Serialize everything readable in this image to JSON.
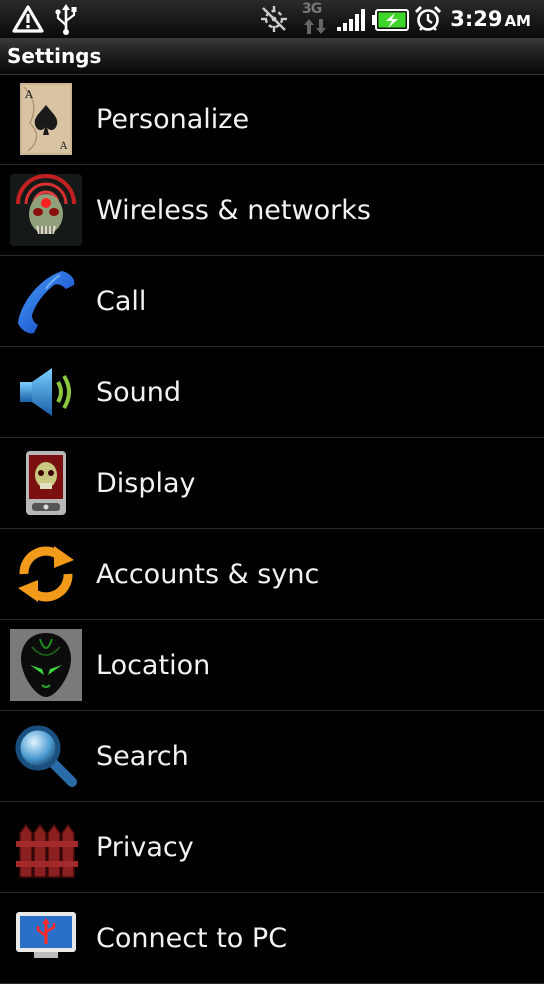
{
  "status_bar": {
    "time": "3:29",
    "ampm": "AM",
    "network_label": "3G",
    "icons": [
      "warning-icon",
      "usb-icon",
      "gps-icon",
      "3g-icon",
      "signal-icon",
      "battery-charging-icon",
      "alarm-icon"
    ],
    "colors": {
      "battery_fill": "#3fd52a"
    }
  },
  "header": {
    "title": "Settings"
  },
  "settings": {
    "items": [
      {
        "label": "Personalize",
        "icon": "ace-of-spades-card-icon"
      },
      {
        "label": "Wireless & networks",
        "icon": "skull-radar-icon"
      },
      {
        "label": "Call",
        "icon": "phone-handset-icon"
      },
      {
        "label": "Sound",
        "icon": "speaker-icon"
      },
      {
        "label": "Display",
        "icon": "phone-display-icon"
      },
      {
        "label": "Accounts & sync",
        "icon": "sync-arrows-icon"
      },
      {
        "label": "Location",
        "icon": "alien-head-icon"
      },
      {
        "label": "Search",
        "icon": "magnifier-icon"
      },
      {
        "label": "Privacy",
        "icon": "fence-icon"
      },
      {
        "label": "Connect to PC",
        "icon": "usb-monitor-icon"
      }
    ]
  }
}
